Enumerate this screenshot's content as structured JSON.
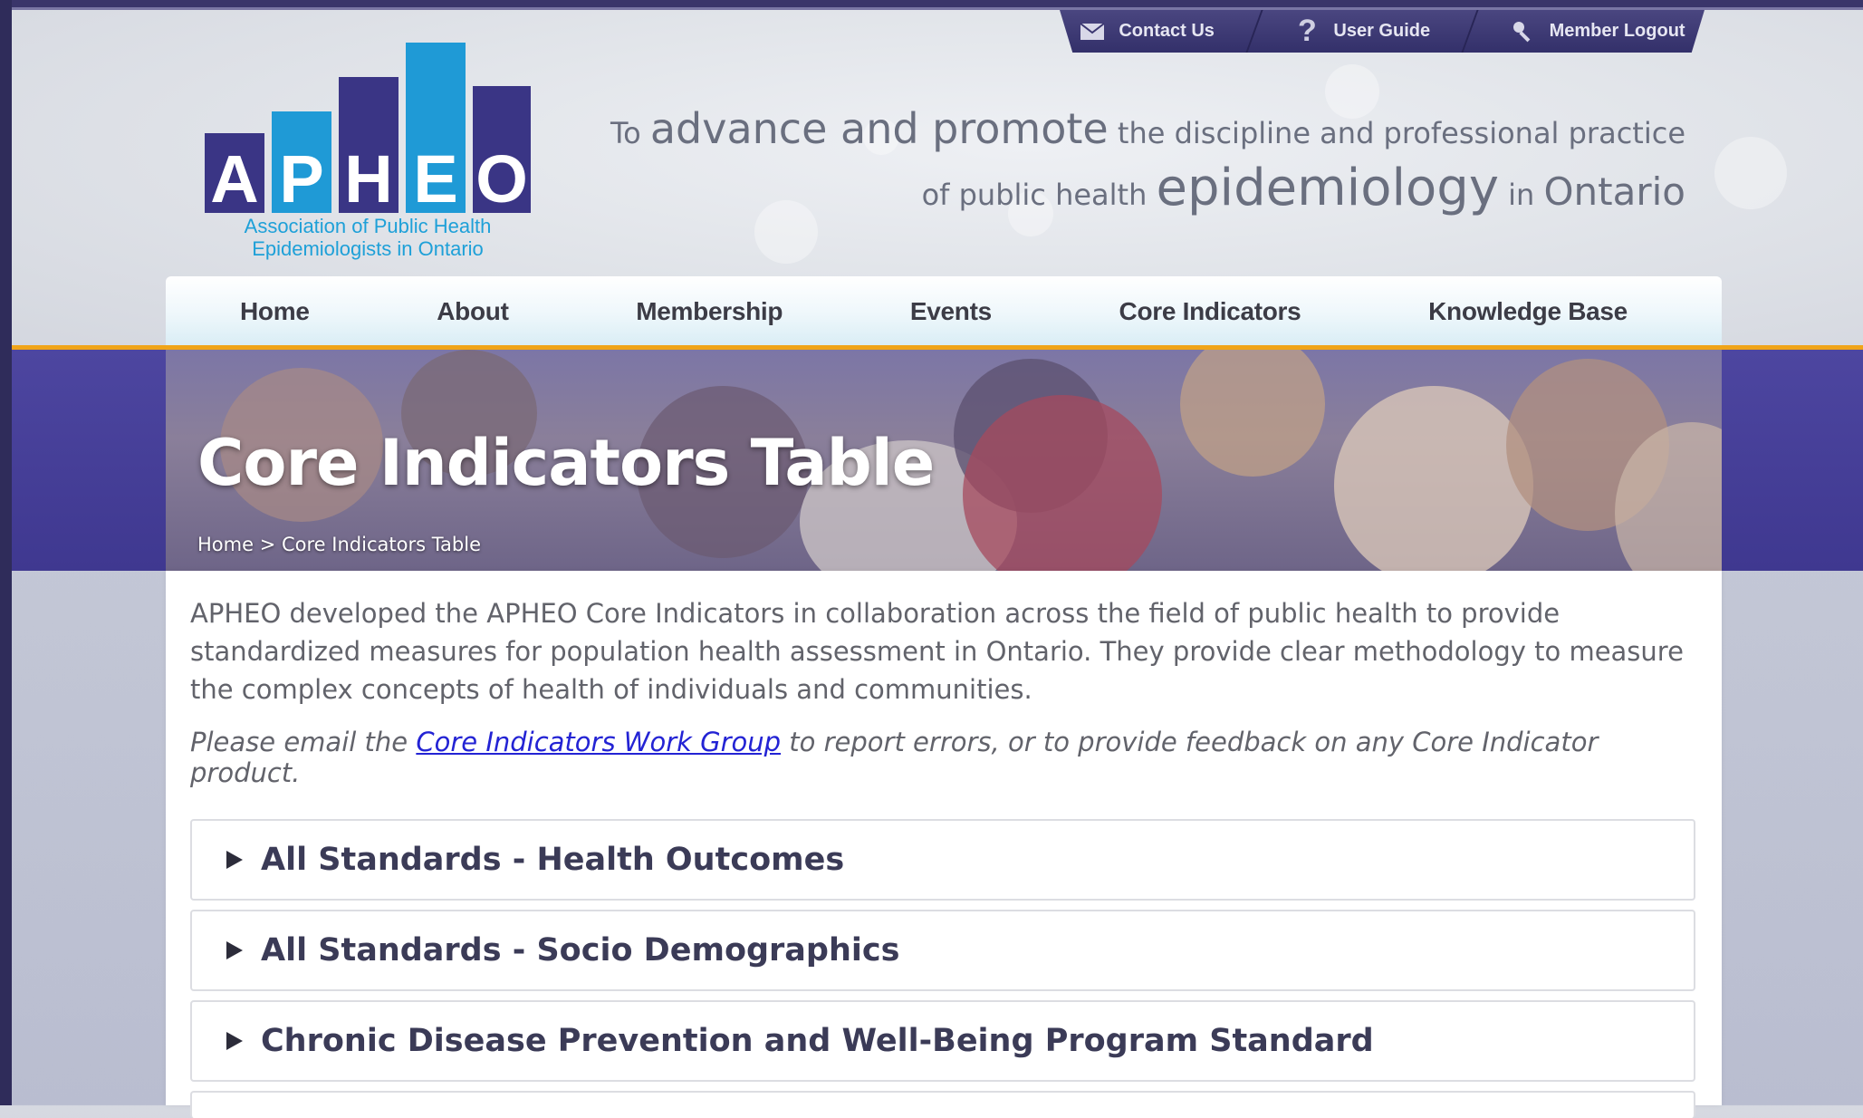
{
  "utility_bar": {
    "items": [
      {
        "label": "Contact Us",
        "icon": "envelope-icon"
      },
      {
        "label": "User Guide",
        "icon": "question-icon"
      },
      {
        "label": "Member Logout",
        "icon": "key-icon"
      }
    ]
  },
  "logo": {
    "letters": [
      "A",
      "P",
      "H",
      "E",
      "O"
    ],
    "caption_line1": "Association of Public Health",
    "caption_line2": "Epidemiologists in Ontario",
    "colors": {
      "purple": "#3a3585",
      "blue": "#1f9ad6"
    }
  },
  "tagline": {
    "w1": "To",
    "w2": "advance and promote",
    "w3": "the discipline and professional practice",
    "w4": "of public health",
    "w5": "epidemiology",
    "w6": "in",
    "w7": "Ontario"
  },
  "nav": {
    "items": [
      "Home",
      "About",
      "Membership",
      "Events",
      "Core Indicators",
      "Knowledge Base"
    ],
    "accent": "#f0a419"
  },
  "banner": {
    "title": "Core Indicators Table",
    "breadcrumb_home": "Home",
    "breadcrumb_sep": ">",
    "breadcrumb_current": "Core Indicators Table"
  },
  "content": {
    "intro": "APHEO developed the APHEO Core Indicators in collaboration across the field of public health to provide standardized measures for population health assessment in Ontario. They provide clear methodology to measure the complex concepts of health of individuals and communities.",
    "note_before": "Please email the",
    "note_link": "Core Indicators Work Group",
    "note_after": "to report errors, or to provide feedback on any Core Indicator product.",
    "accordions": [
      "All Standards - Health Outcomes",
      "All Standards - Socio Demographics",
      "Chronic Disease Prevention and Well-Being Program Standard"
    ]
  }
}
